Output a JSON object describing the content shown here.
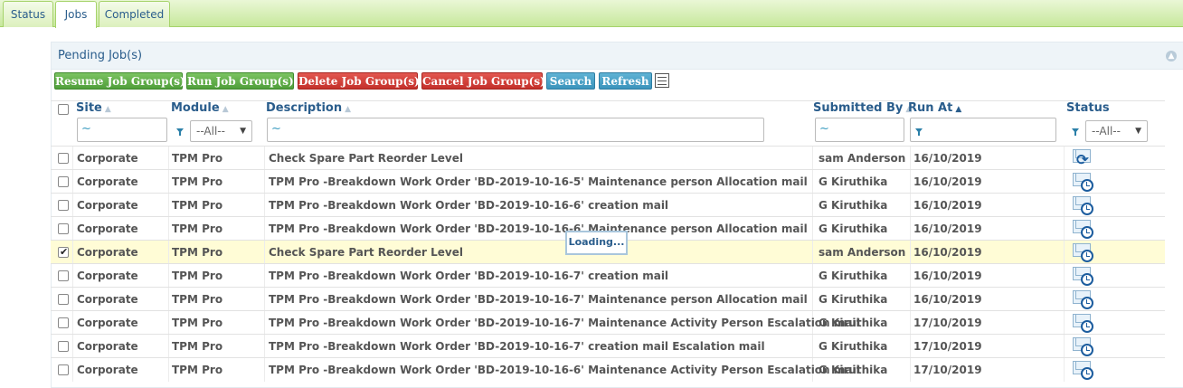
{
  "tabs": [
    {
      "label": "Status",
      "active": false
    },
    {
      "label": "Jobs",
      "active": true
    },
    {
      "label": "Completed",
      "active": false
    }
  ],
  "panel": {
    "title": "Pending Job(s)",
    "collapse_icon": "chevron-up-icon"
  },
  "toolbar": {
    "resume": "Resume Job Group(s)",
    "run": "Run Job Group(s)",
    "delete": "Delete Job Group(s)",
    "cancel": "Cancel Job Group(s)",
    "search": "Search",
    "refresh": "Refresh",
    "columns_icon": "column-chooser-icon"
  },
  "columns": {
    "site": "Site",
    "module": "Module",
    "description": "Description",
    "submitted_by": "Submitted By",
    "run_at": "Run At",
    "status": "Status"
  },
  "filters": {
    "site": "~",
    "module": "--All--",
    "description": "~",
    "submitted_by": "~",
    "status": "--All--"
  },
  "rows": [
    {
      "checked": false,
      "site": "Corporate",
      "module": "TPM Pro",
      "description": "Check Spare Part Reorder Level",
      "submitted_by": "sam Anderson",
      "run_at": "16/10/2019",
      "status_icon": "running-refresh-icon"
    },
    {
      "checked": false,
      "site": "Corporate",
      "module": "TPM Pro",
      "description": "TPM Pro -Breakdown Work Order 'BD-2019-10-16-5' Maintenance person Allocation mail",
      "submitted_by": "G Kiruthika",
      "run_at": "16/10/2019",
      "status_icon": "scheduled-mail-icon"
    },
    {
      "checked": false,
      "site": "Corporate",
      "module": "TPM Pro",
      "description": "TPM Pro -Breakdown Work Order 'BD-2019-10-16-6' creation mail",
      "submitted_by": "G Kiruthika",
      "run_at": "16/10/2019",
      "status_icon": "scheduled-mail-icon"
    },
    {
      "checked": false,
      "site": "Corporate",
      "module": "TPM Pro",
      "description": "TPM Pro -Breakdown Work Order 'BD-2019-10-16-6' Maintenance person Allocation mail",
      "submitted_by": "G Kiruthika",
      "run_at": "16/10/2019",
      "status_icon": "scheduled-mail-icon"
    },
    {
      "checked": true,
      "site": "Corporate",
      "module": "TPM Pro",
      "description": "Check Spare Part Reorder Level",
      "submitted_by": "sam Anderson",
      "run_at": "16/10/2019",
      "status_icon": "scheduled-mail-icon"
    },
    {
      "checked": false,
      "site": "Corporate",
      "module": "TPM Pro",
      "description": "TPM Pro -Breakdown Work Order 'BD-2019-10-16-7' creation mail",
      "submitted_by": "G Kiruthika",
      "run_at": "16/10/2019",
      "status_icon": "scheduled-mail-icon"
    },
    {
      "checked": false,
      "site": "Corporate",
      "module": "TPM Pro",
      "description": "TPM Pro -Breakdown Work Order 'BD-2019-10-16-7' Maintenance person Allocation mail",
      "submitted_by": "G Kiruthika",
      "run_at": "16/10/2019",
      "status_icon": "scheduled-mail-icon"
    },
    {
      "checked": false,
      "site": "Corporate",
      "module": "TPM Pro",
      "description": "TPM Pro -Breakdown Work Order 'BD-2019-10-16-7' Maintenance Activity Person Escalation mail",
      "submitted_by": "G Kiruthika",
      "run_at": "17/10/2019",
      "status_icon": "scheduled-mail-icon"
    },
    {
      "checked": false,
      "site": "Corporate",
      "module": "TPM Pro",
      "description": "TPM Pro -Breakdown Work Order 'BD-2019-10-16-7' creation mail Escalation mail",
      "submitted_by": "G Kiruthika",
      "run_at": "17/10/2019",
      "status_icon": "scheduled-mail-icon"
    },
    {
      "checked": false,
      "site": "Corporate",
      "module": "TPM Pro",
      "description": "TPM Pro -Breakdown Work Order 'BD-2019-10-16-6' Maintenance Activity Person Escalation mail",
      "submitted_by": "G Kiruthika",
      "run_at": "17/10/2019",
      "status_icon": "scheduled-mail-icon"
    }
  ],
  "loading_text": "Loading...",
  "colors": {
    "accent": "#2a5d8c",
    "green": "#4f9e3a",
    "red": "#c4302a",
    "blue": "#3b94bc",
    "selected_row": "#fffcd6"
  }
}
